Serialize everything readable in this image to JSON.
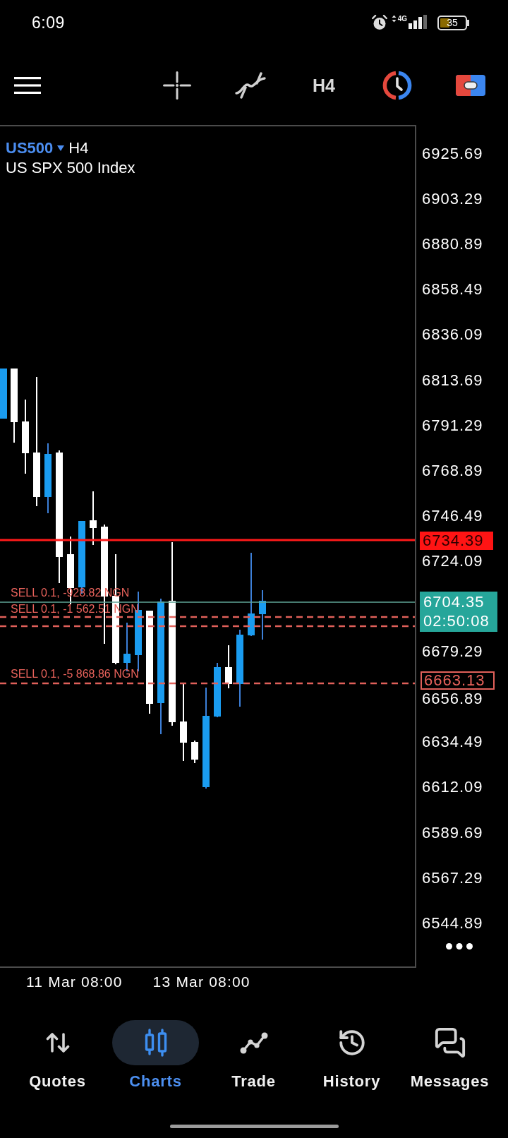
{
  "status_bar": {
    "time": "6:09",
    "network": "4G",
    "battery": "35"
  },
  "toolbar": {
    "timeframe": "H4"
  },
  "chart": {
    "symbol": "US500",
    "timeframe": "H4",
    "description": "US SPX 500 Index",
    "orders": [
      {
        "label": "SELL 0.1, -928.82 NGN"
      },
      {
        "label": "SELL 0.1, -1 562.51 NGN"
      },
      {
        "label": "SELL 0.1, -5 868.86 NGN"
      }
    ],
    "price_scale": [
      "6925.69",
      "6903.29",
      "6880.89",
      "6858.49",
      "6836.09",
      "6813.69",
      "6791.29",
      "6768.89",
      "6746.49",
      "6724.09",
      "6679.29",
      "6656.89",
      "6634.49",
      "6612.09",
      "6589.69",
      "6567.29",
      "6544.89"
    ],
    "price_line": "6734.39",
    "current_price": {
      "price": "6704.35",
      "countdown": "02:50:08"
    },
    "order_price": "6663.13",
    "time_scale": [
      "11 Mar 08:00",
      "13 Mar 08:00"
    ]
  },
  "nav": [
    {
      "label": "Quotes",
      "selected": false
    },
    {
      "label": "Charts",
      "selected": true
    },
    {
      "label": "Trade",
      "selected": false
    },
    {
      "label": "History",
      "selected": false
    },
    {
      "label": "Messages",
      "selected": false
    }
  ]
}
